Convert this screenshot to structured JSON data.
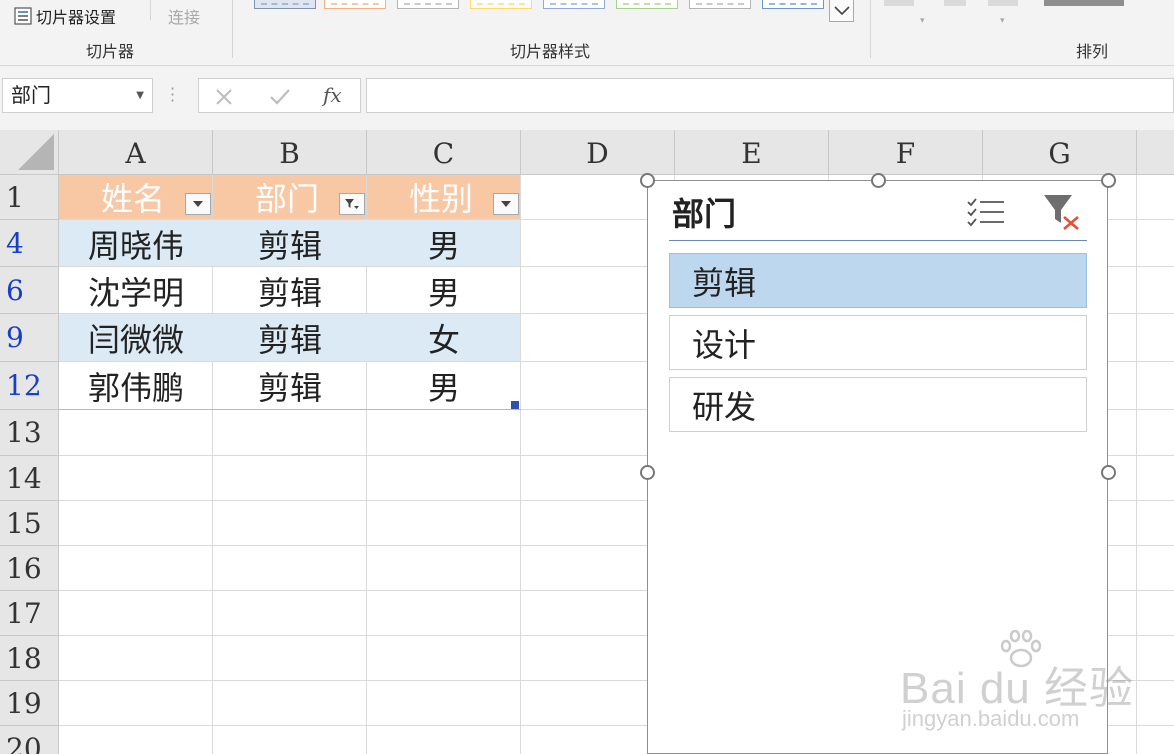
{
  "ribbon": {
    "slicer_settings_label": "切片器设置",
    "connections_label": "连接",
    "slicer_group_label": "切片器",
    "slicer_styles_group_label": "切片器样式",
    "arrange_group_label": "排列",
    "style_swatch_colors": [
      "#8ea9c8",
      "#f4b183",
      "#b4b4b4",
      "#ffd966",
      "#8eaadb",
      "#a9d18e",
      "#b4b4b4",
      "#6f96c8"
    ]
  },
  "formula_bar": {
    "name_box_value": "部门",
    "cancel_icon": "close-icon",
    "enter_icon": "check-icon",
    "fx_label": "fx",
    "formula_value": ""
  },
  "columns": [
    "A",
    "B",
    "C",
    "D",
    "E",
    "F",
    "G"
  ],
  "rows": [
    "1",
    "4",
    "6",
    "9",
    "12",
    "13",
    "14",
    "15",
    "16",
    "17",
    "18",
    "19",
    "20"
  ],
  "table": {
    "headers": [
      "姓名",
      "部门",
      "性别"
    ],
    "data": [
      [
        "周晓伟",
        "剪辑",
        "男"
      ],
      [
        "沈学明",
        "剪辑",
        "男"
      ],
      [
        "闫微微",
        "剪辑",
        "女"
      ],
      [
        "郭伟鹏",
        "剪辑",
        "男"
      ]
    ],
    "header_color": "#f8c7a4",
    "band_color": "#dceaf6"
  },
  "slicer": {
    "title": "部门",
    "multi_select_icon": "multi-select-icon",
    "clear_filter_icon": "clear-filter-icon",
    "items": [
      {
        "label": "剪辑",
        "selected": true
      },
      {
        "label": "设计",
        "selected": false
      },
      {
        "label": "研发",
        "selected": false
      }
    ],
    "selected_color": "#bdd7ee"
  },
  "watermark": {
    "brand": "Bai du 经验",
    "url": "jingyan.baidu.com"
  }
}
